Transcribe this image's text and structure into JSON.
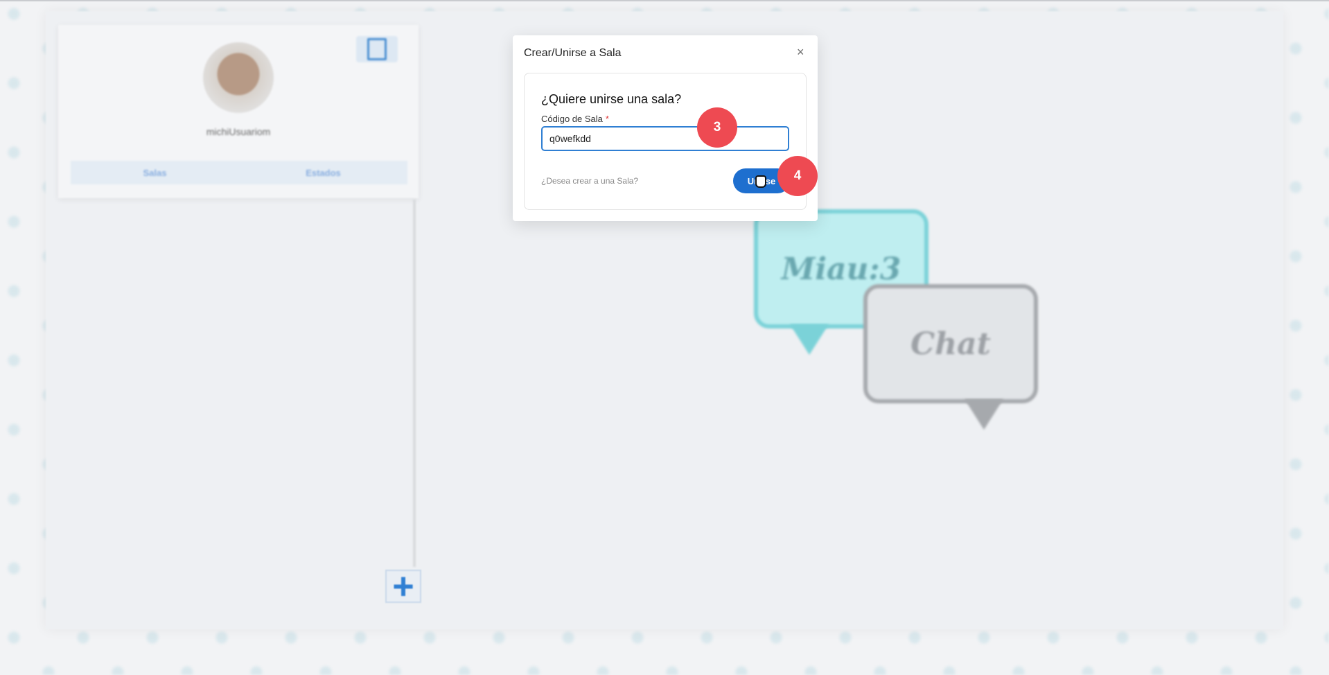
{
  "background_app": {
    "username": "michiUsuariom",
    "tabs": [
      "Salas",
      "Estados"
    ],
    "bubbles": {
      "miau": "Miau:3",
      "chat": "Chat"
    },
    "add_button_icon": "plus-icon",
    "logout_icon": "logout-icon"
  },
  "modal": {
    "title": "Crear/Unirse a Sala",
    "close_label": "×",
    "heading": "¿Quiere unirse una sala?",
    "field_label": "Código de Sala",
    "required_marker": "*",
    "code_value": "q0wefkdd",
    "create_link": "¿Desea crear a una Sala?",
    "join_label": "Unirse"
  },
  "markers": [
    "3",
    "4"
  ],
  "colors": {
    "primary": "#1e6fcf",
    "marker": "#ee4a52",
    "bubble_miau": "#bfeef0",
    "bubble_chat": "#e2e5e8"
  }
}
